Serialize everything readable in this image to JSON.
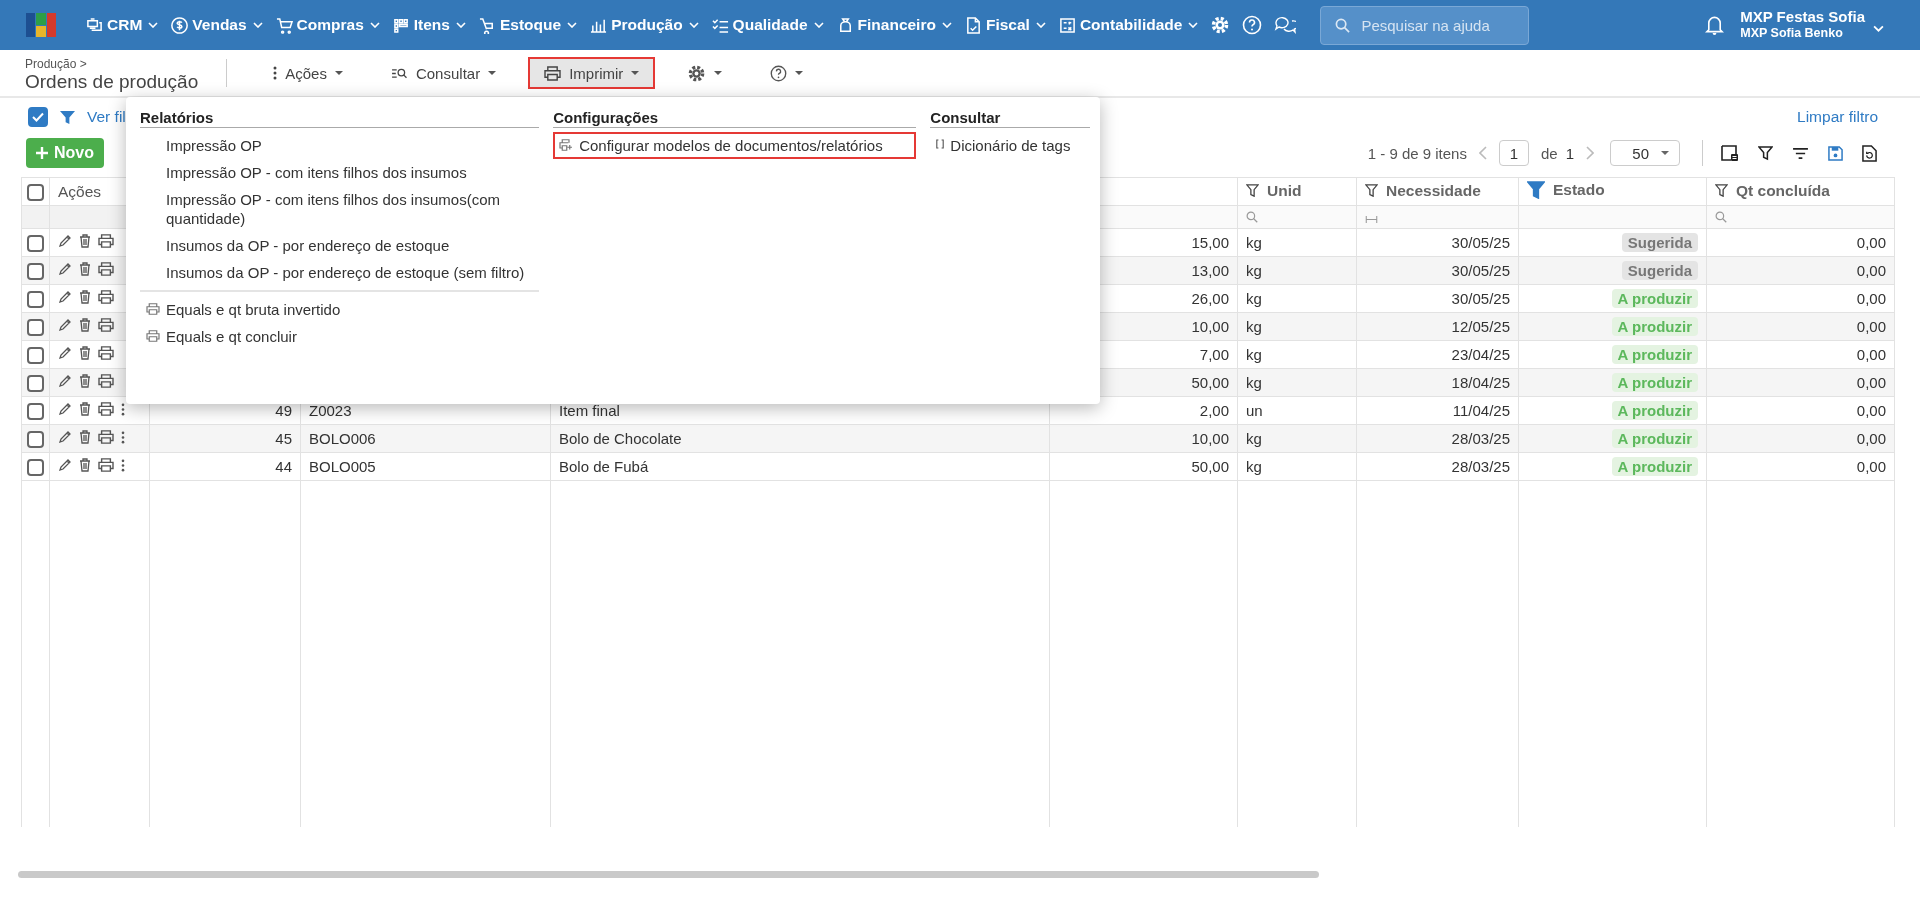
{
  "topbar": {
    "nav": [
      {
        "label": "CRM"
      },
      {
        "label": "Vendas"
      },
      {
        "label": "Compras"
      },
      {
        "label": "Itens"
      },
      {
        "label": "Estoque"
      },
      {
        "label": "Produção"
      },
      {
        "label": "Qualidade"
      },
      {
        "label": "Financeiro"
      },
      {
        "label": "Fiscal"
      },
      {
        "label": "Contabilidade"
      }
    ],
    "search": {
      "placeholder": "Pesquisar na ajuda"
    },
    "user": {
      "company": "MXP Festas Sofia",
      "name": "MXP Sofia Benko"
    }
  },
  "header": {
    "breadcrumb": "Produção >",
    "title": "Ordens de produção"
  },
  "toolbar": [
    {
      "kind": "actions",
      "label": "Ações",
      "active": false,
      "highlighted": false
    },
    {
      "kind": "search",
      "label": "Consultar",
      "active": false,
      "highlighted": false
    },
    {
      "kind": "print",
      "label": "Imprimir",
      "active": true,
      "highlighted": true
    },
    {
      "kind": "settings",
      "active": false,
      "highlighted": false
    },
    {
      "kind": "help",
      "active": false,
      "highlighted": false
    }
  ],
  "filter_bar": {
    "checked": true,
    "link": "Ver fil",
    "clear": "Limpar filtro"
  },
  "new_button": "Novo",
  "pager": {
    "range": "1 - 9 de 9 itens",
    "page": "1",
    "of": "de",
    "total": "1",
    "page_size": "50"
  },
  "table": {
    "header_checked": false,
    "actions_label": "Ações",
    "columns": [
      {
        "label": "Unid",
        "filtered": false,
        "kind": "search_filter"
      },
      {
        "label": "Necessidade",
        "filtered": false,
        "kind": "range_filter"
      },
      {
        "label": "Estado",
        "filtered": true,
        "kind": "no_filter"
      },
      {
        "label": "Qt concluída",
        "filtered": false,
        "kind": "search_filter"
      }
    ],
    "rows": [
      {
        "checked": false,
        "covered": true,
        "quantity": "15,00",
        "unit": "kg",
        "date": "30/05/25",
        "status": {
          "label": "Sugerida",
          "kind": "suggested"
        },
        "done": "0,00"
      },
      {
        "checked": false,
        "covered": true,
        "quantity": "13,00",
        "unit": "kg",
        "date": "30/05/25",
        "status": {
          "label": "Sugerida",
          "kind": "suggested"
        },
        "done": "0,00"
      },
      {
        "checked": false,
        "covered": true,
        "quantity": "26,00",
        "unit": "kg",
        "date": "30/05/25",
        "status": {
          "label": "A produzir",
          "kind": "to_produce"
        },
        "done": "0,00"
      },
      {
        "checked": false,
        "covered": true,
        "quantity": "10,00",
        "unit": "kg",
        "date": "12/05/25",
        "status": {
          "label": "A produzir",
          "kind": "to_produce"
        },
        "done": "0,00"
      },
      {
        "checked": false,
        "covered": true,
        "quantity": "7,00",
        "unit": "kg",
        "date": "23/04/25",
        "status": {
          "label": "A produzir",
          "kind": "to_produce"
        },
        "done": "0,00"
      },
      {
        "checked": false,
        "covered": true,
        "quantity": "50,00",
        "unit": "kg",
        "date": "18/04/25",
        "status": {
          "label": "A produzir",
          "kind": "to_produce"
        },
        "done": "0,00"
      },
      {
        "checked": false,
        "covered": false,
        "number": "49",
        "code": "Z0023",
        "description": "Item final",
        "quantity": "2,00",
        "unit": "un",
        "date": "11/04/25",
        "status": {
          "label": "A produzir",
          "kind": "to_produce"
        },
        "done": "0,00"
      },
      {
        "checked": false,
        "covered": false,
        "number": "45",
        "code": "BOLO006",
        "description": "Bolo de Chocolate",
        "quantity": "10,00",
        "unit": "kg",
        "date": "28/03/25",
        "status": {
          "label": "A produzir",
          "kind": "to_produce"
        },
        "done": "0,00"
      },
      {
        "checked": false,
        "covered": false,
        "number": "44",
        "code": "BOLO005",
        "description": "Bolo de Fubá",
        "quantity": "50,00",
        "unit": "kg",
        "date": "28/03/25",
        "status": {
          "label": "A produzir",
          "kind": "to_produce"
        },
        "done": "0,00"
      }
    ]
  },
  "print_menu": {
    "sections": [
      {
        "title": "Relatórios",
        "items": [
          {
            "label": "Impressão OP",
            "kind": "report",
            "highlighted": false
          },
          {
            "label": "Impressão OP - com itens filhos dos insumos",
            "kind": "report",
            "highlighted": false
          },
          {
            "label": "Impressão OP - com itens filhos dos insumos(com quantidade)",
            "kind": "report",
            "highlighted": false
          },
          {
            "label": "Insumos da OP - por endereço de estoque",
            "kind": "report",
            "highlighted": false
          },
          {
            "label": "Insumos da OP - por endereço de estoque (sem filtro)",
            "kind": "report",
            "highlighted": false
          },
          {
            "label": "Equals e qt bruta invertido",
            "kind": "custom",
            "highlighted": false
          },
          {
            "label": "Equals e qt concluir",
            "kind": "custom",
            "highlighted": false
          }
        ]
      },
      {
        "title": "Configurações",
        "items": [
          {
            "label": "Configurar modelos de documentos/relatórios",
            "kind": "config",
            "highlighted": true
          }
        ]
      },
      {
        "title": "Consultar",
        "items": [
          {
            "label": "Dicionário de tags",
            "kind": "tags",
            "highlighted": false
          }
        ]
      }
    ]
  }
}
